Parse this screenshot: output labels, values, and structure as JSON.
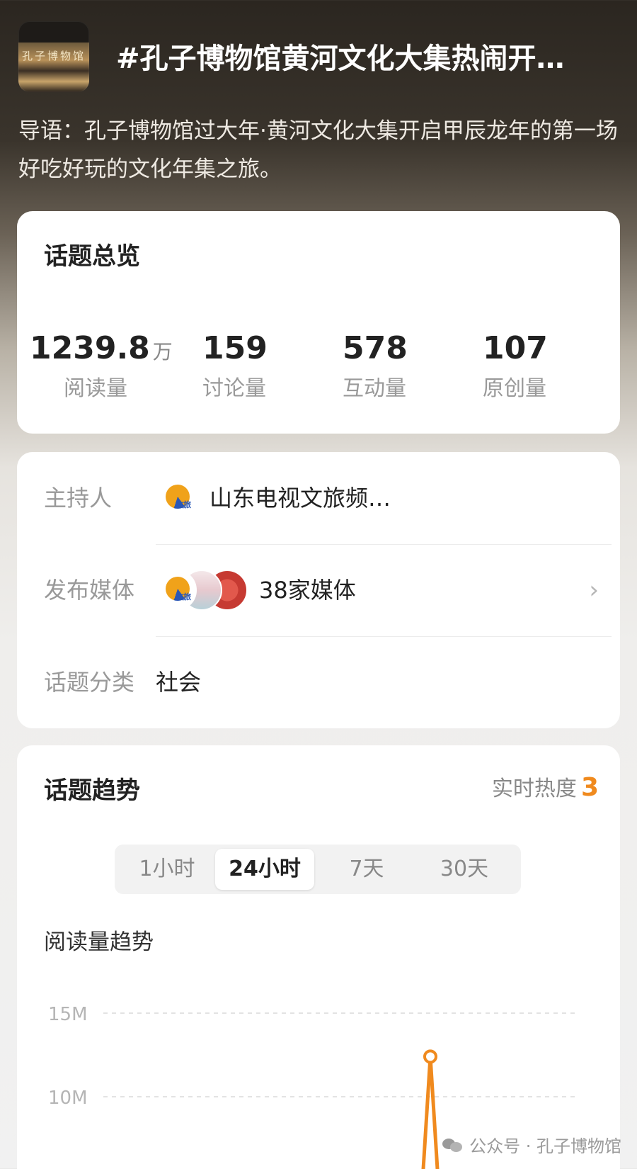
{
  "header": {
    "logo_text": "孔子博物馆",
    "title": "#孔子博物馆黄河文化大集热闹开…",
    "intro": "导语：孔子博物馆过大年·黄河文化大集开启甲辰龙年的第一场好吃好玩的文化年集之旅。"
  },
  "overview": {
    "title": "话题总览",
    "stats": [
      {
        "value": "1239.8",
        "unit": "万",
        "label": "阅读量"
      },
      {
        "value": "159",
        "unit": "",
        "label": "讨论量"
      },
      {
        "value": "578",
        "unit": "",
        "label": "互动量"
      },
      {
        "value": "107",
        "unit": "",
        "label": "原创量"
      }
    ]
  },
  "info": {
    "host_label": "主持人",
    "host_name": "山东电视文旅频…",
    "host_avatar_tag": "文旅",
    "media_label": "发布媒体",
    "media_count": "38家媒体",
    "category_label": "话题分类",
    "category_value": "社会"
  },
  "trend": {
    "title": "话题趋势",
    "heat_label": "实时热度",
    "heat_value": "3",
    "tabs": [
      "1小时",
      "24小时",
      "7天",
      "30天"
    ],
    "active_tab": 1,
    "chart_title": "阅读量趋势"
  },
  "chart_data": {
    "type": "line",
    "title": "阅读量趋势",
    "ylabel": "",
    "y_ticks": [
      "15M",
      "10M"
    ],
    "ylim": [
      5,
      15
    ],
    "grid": true,
    "series": [
      {
        "x": [
          0,
          1
        ],
        "values": [
          12.4,
          5
        ],
        "color": "#f08a1e"
      }
    ],
    "point_value": 12.4,
    "color": "#f08a1e"
  },
  "watermark": {
    "text": "公众号 · 孔子博物馆"
  }
}
